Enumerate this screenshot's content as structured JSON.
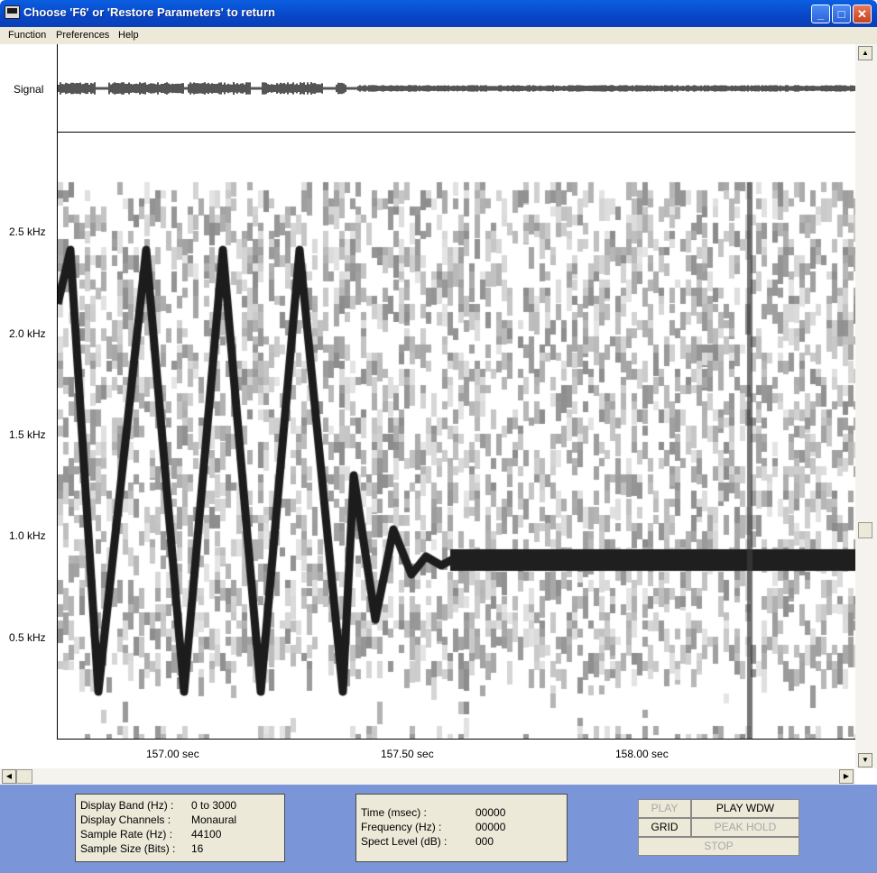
{
  "window": {
    "title": "Choose 'F6' or 'Restore Parameters' to return"
  },
  "menu": [
    "Function",
    "Preferences",
    "Help"
  ],
  "signal_label": "Signal",
  "y_axis_labels": [
    "2.5 kHz",
    "2.0 kHz",
    "1.5 kHz",
    "1.0 kHz",
    "0.5 kHz"
  ],
  "x_axis_labels": [
    "157.00 sec",
    "157.50 sec",
    "158.00 sec"
  ],
  "display_info": {
    "rows": [
      {
        "label": "Display Band (Hz) :",
        "value": "0 to 3000"
      },
      {
        "label": "Display Channels :",
        "value": "Monaural"
      },
      {
        "label": "Sample Rate (Hz) :",
        "value": "44100"
      },
      {
        "label": "Sample Size (Bits) :",
        "value": "16"
      }
    ]
  },
  "cursor_info": {
    "rows": [
      {
        "label": "Time (msec) :",
        "value": "00000"
      },
      {
        "label": "Frequency (Hz) :",
        "value": "00000"
      },
      {
        "label": "Spect Level (dB) :",
        "value": "000"
      }
    ]
  },
  "buttons": {
    "play": "PLAY",
    "play_wdw": "PLAY WDW",
    "grid": "GRID",
    "peak_hold": "PEAK HOLD",
    "stop": "STOP"
  }
}
